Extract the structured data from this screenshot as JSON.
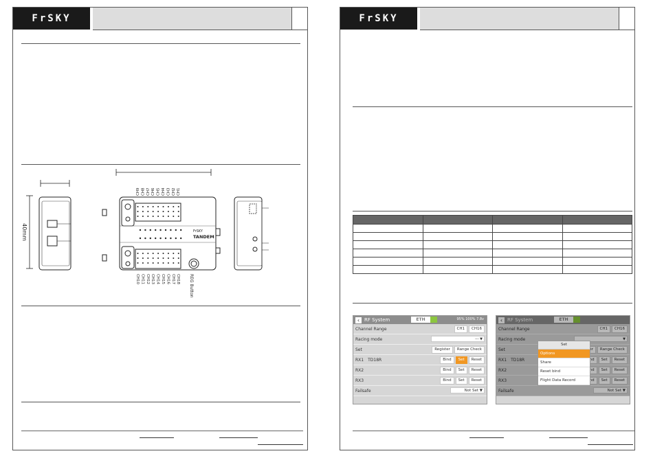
{
  "brand": {
    "logo_text": "FrSKY"
  },
  "receiver_diagram": {
    "top_channels": [
      "CH9",
      "CH8",
      "CH7",
      "CH6",
      "CH5",
      "CH4",
      "CH3",
      "CH2",
      "CH1"
    ],
    "bottom_channels": [
      "CH10",
      "CH11",
      "CH12",
      "CH13",
      "CH14",
      "CH15",
      "CH16",
      "CH17",
      "CH18"
    ],
    "side_dimension": "40mm",
    "reg_button_label": "REG Button",
    "label_on_device": "TANDEM"
  },
  "screens": {
    "left": {
      "title": "RF System",
      "eth": "ETH",
      "status": "95% 100% 7.8v",
      "rows": [
        {
          "label": "Channel Range",
          "buttons": [
            "CH1",
            "CH16"
          ]
        },
        {
          "label": "Racing mode",
          "dropdown": "---"
        },
        {
          "label": "Set",
          "buttons": [
            "Register",
            "Range Check"
          ]
        },
        {
          "label": "RX1",
          "rx_name": "TD18R",
          "buttons": [
            "Bind",
            "Set",
            "Reset"
          ],
          "active": "Set"
        },
        {
          "label": "RX2",
          "buttons": [
            "Bind",
            "Set",
            "Reset"
          ]
        },
        {
          "label": "RX3",
          "buttons": [
            "Bind",
            "Set",
            "Reset"
          ]
        },
        {
          "label": "Failsafe",
          "dropdown": "Not Set"
        }
      ]
    },
    "right": {
      "title": "RF System",
      "eth": "ETH",
      "rows": [
        {
          "label": "Channel Range",
          "buttons": [
            "CH1",
            "CH16"
          ]
        },
        {
          "label": "Racing mode",
          "dropdown": ""
        },
        {
          "label": "Set",
          "buttons": [
            "ster",
            "Range Check"
          ]
        },
        {
          "label": "RX1",
          "rx_name": "TD18R",
          "buttons": [
            "Bind",
            "Set",
            "Reset"
          ]
        },
        {
          "label": "RX2",
          "buttons": [
            "Bind",
            "Set",
            "Reset"
          ]
        },
        {
          "label": "RX3",
          "buttons": [
            "Bind",
            "Set",
            "Reset"
          ]
        },
        {
          "label": "Failsafe",
          "dropdown": "Not Set"
        }
      ],
      "popup": {
        "title": "Set",
        "items": [
          "Options",
          "Share",
          "Reset bind",
          "Flight Data Record"
        ],
        "selected": "Options"
      }
    }
  },
  "colors": {
    "accent": "#f19722",
    "eth_green": "#8cc63f",
    "header_dark": "#1a1a1a"
  }
}
